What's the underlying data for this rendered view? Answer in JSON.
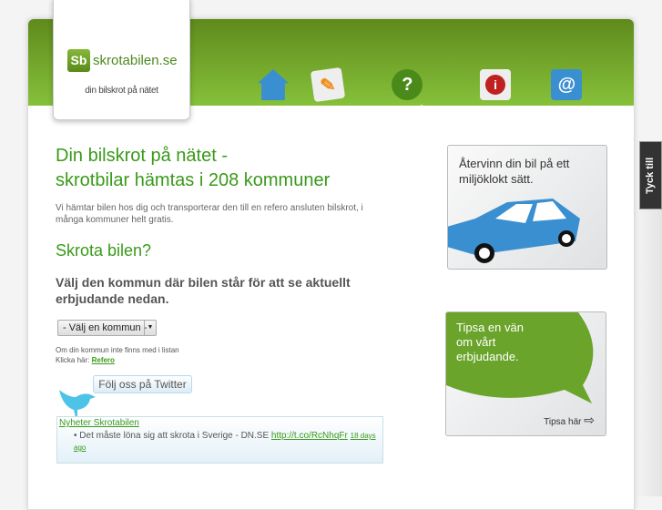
{
  "logo": {
    "mark": "Sb",
    "name": "skrotabilen.se",
    "tagline": "din bilskrot på nätet"
  },
  "nav": [
    {
      "label": "hem",
      "icon": "house-icon"
    },
    {
      "label": "beställning",
      "icon": "order-form-icon"
    },
    {
      "label": "vanliga frågor",
      "icon": "question-bubble-icon"
    },
    {
      "label": "om skrotabilen",
      "icon": "info-house-icon"
    },
    {
      "label": "kontakt",
      "icon": "email-icon"
    }
  ],
  "main": {
    "title_line1": "Din bilskrot på nätet -",
    "title_line2": "skrotbilar hämtas i 208 kommuner",
    "intro": "Vi hämtar bilen hos dig och transporterar den till en refero ansluten bilskrot, i många kommuner helt gratis.",
    "section_title": "Skrota bilen?",
    "lead": "Välj den kommun där bilen står för att se aktuellt erbjudande nedan.",
    "select_value": "- Välj en kommun -",
    "missing_text": "Om din kommun inte finns med i listan",
    "click_here": "Klicka här:",
    "refero_link": "Refero"
  },
  "twitter": {
    "follow": "Följ oss på Twitter",
    "feed_title": "Nyheter Skrotabilen",
    "tweet_text": "Det måste löna sig att skrota i Sverige - DN.SE",
    "tweet_link": "http://t.co/RcNhqFr",
    "tweet_age": "18 days ago"
  },
  "sidebar": {
    "recycle_text": "Återvinn din bil på ett miljöklokt sätt.",
    "tip_text": "Tipsa en vän om vårt erbjudande.",
    "tip_link": "Tipsa här"
  },
  "feedback_tab": "Tyck till"
}
